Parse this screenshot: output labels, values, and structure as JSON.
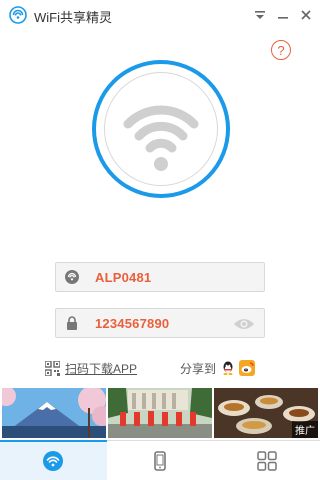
{
  "window": {
    "title": "WiFi共享精灵",
    "help_glyph": "?"
  },
  "wifi": {
    "ssid": "ALP0481",
    "password": "1234567890"
  },
  "links": {
    "scan_download": "扫码下载APP",
    "share_to": "分享到"
  },
  "ads": {
    "badge": "推广",
    "items": [
      "mount-fuji-cherry-blossom",
      "dancers-performance",
      "food-table"
    ]
  },
  "tabs": [
    {
      "name": "wifi",
      "icon": "wifi-icon",
      "active": true
    },
    {
      "name": "phone",
      "icon": "phone-icon",
      "active": false
    },
    {
      "name": "apps",
      "icon": "grid-icon",
      "active": false
    }
  ],
  "colors": {
    "accent": "#1a9ae8",
    "value_text": "#e8603c",
    "wifi_gray": "#cfcfcf"
  }
}
